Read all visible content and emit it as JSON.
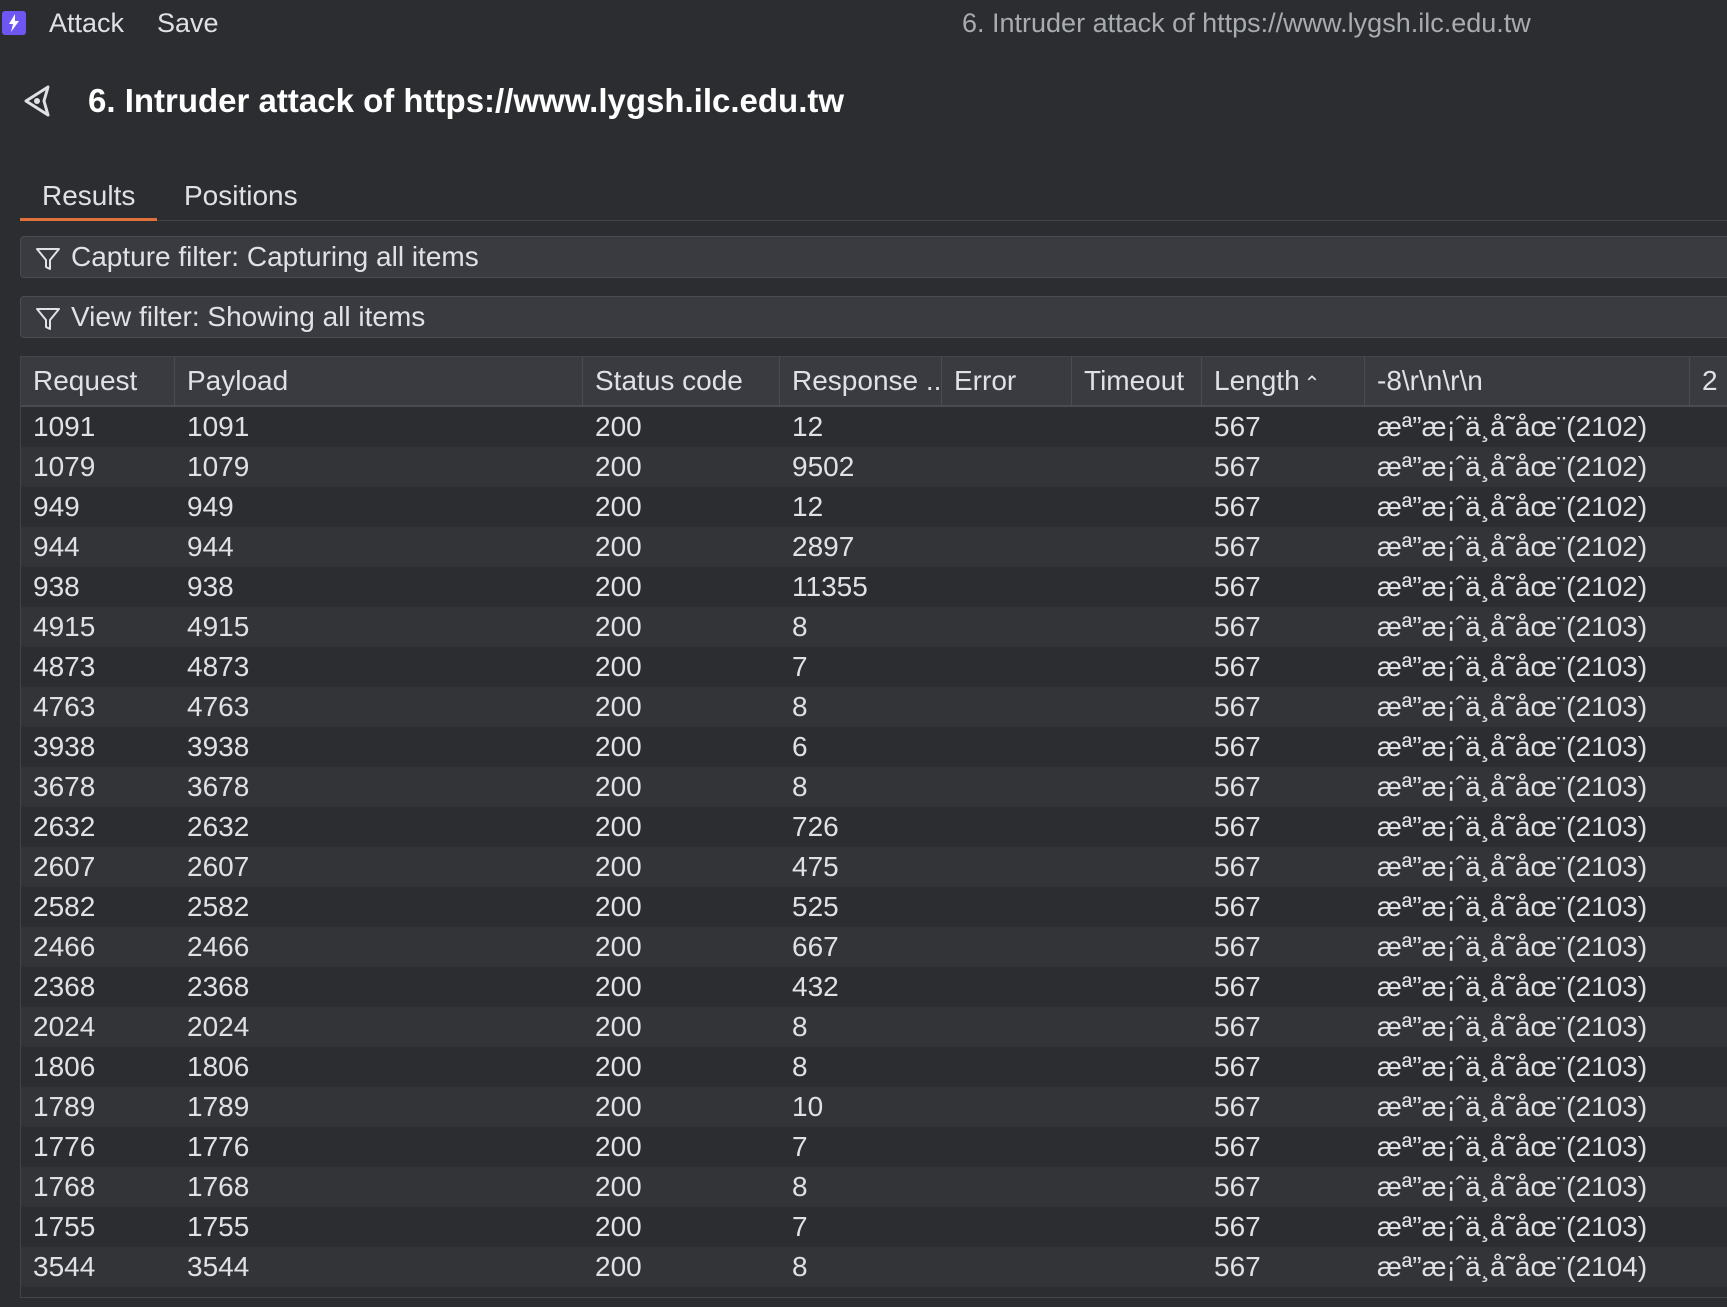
{
  "menubar": {
    "items": [
      "Attack",
      "Save"
    ],
    "window_title": "6. Intruder attack of https://www.lygsh.ilc.edu.tw"
  },
  "header": {
    "title": "6. Intruder attack of https://www.lygsh.ilc.edu.tw",
    "icon": "intruder-icon"
  },
  "tabs": [
    {
      "label": "Results",
      "active": true
    },
    {
      "label": "Positions",
      "active": false
    }
  ],
  "filters": {
    "capture": "Capture filter: Capturing all items",
    "view": "View filter: Showing all items"
  },
  "table": {
    "columns": [
      "Request",
      "Payload",
      "Status code",
      "Response ...",
      "Error",
      "Timeout",
      "Length",
      "-8\\r\\n\\r\\n",
      "2"
    ],
    "sort_column": "Length",
    "sort_direction": "ascending",
    "rows": [
      [
        "1091",
        "1091",
        "200",
        "12",
        "",
        "",
        "567",
        "æª”æ¡ˆä¸å­˜åœ¨(2102)"
      ],
      [
        "1079",
        "1079",
        "200",
        "9502",
        "",
        "",
        "567",
        "æª”æ¡ˆä¸å­˜åœ¨(2102)"
      ],
      [
        "949",
        "949",
        "200",
        "12",
        "",
        "",
        "567",
        "æª”æ¡ˆä¸å­˜åœ¨(2102)"
      ],
      [
        "944",
        "944",
        "200",
        "2897",
        "",
        "",
        "567",
        "æª”æ¡ˆä¸å­˜åœ¨(2102)"
      ],
      [
        "938",
        "938",
        "200",
        "11355",
        "",
        "",
        "567",
        "æª”æ¡ˆä¸å­˜åœ¨(2102)"
      ],
      [
        "4915",
        "4915",
        "200",
        "8",
        "",
        "",
        "567",
        "æª”æ¡ˆä¸å­˜åœ¨(2103)"
      ],
      [
        "4873",
        "4873",
        "200",
        "7",
        "",
        "",
        "567",
        "æª”æ¡ˆä¸å­˜åœ¨(2103)"
      ],
      [
        "4763",
        "4763",
        "200",
        "8",
        "",
        "",
        "567",
        "æª”æ¡ˆä¸å­˜åœ¨(2103)"
      ],
      [
        "3938",
        "3938",
        "200",
        "6",
        "",
        "",
        "567",
        "æª”æ¡ˆä¸å­˜åœ¨(2103)"
      ],
      [
        "3678",
        "3678",
        "200",
        "8",
        "",
        "",
        "567",
        "æª”æ¡ˆä¸å­˜åœ¨(2103)"
      ],
      [
        "2632",
        "2632",
        "200",
        "726",
        "",
        "",
        "567",
        "æª”æ¡ˆä¸å­˜åœ¨(2103)"
      ],
      [
        "2607",
        "2607",
        "200",
        "475",
        "",
        "",
        "567",
        "æª”æ¡ˆä¸å­˜åœ¨(2103)"
      ],
      [
        "2582",
        "2582",
        "200",
        "525",
        "",
        "",
        "567",
        "æª”æ¡ˆä¸å­˜åœ¨(2103)"
      ],
      [
        "2466",
        "2466",
        "200",
        "667",
        "",
        "",
        "567",
        "æª”æ¡ˆä¸å­˜åœ¨(2103)"
      ],
      [
        "2368",
        "2368",
        "200",
        "432",
        "",
        "",
        "567",
        "æª”æ¡ˆä¸å­˜åœ¨(2103)"
      ],
      [
        "2024",
        "2024",
        "200",
        "8",
        "",
        "",
        "567",
        "æª”æ¡ˆä¸å­˜åœ¨(2103)"
      ],
      [
        "1806",
        "1806",
        "200",
        "8",
        "",
        "",
        "567",
        "æª”æ¡ˆä¸å­˜åœ¨(2103)"
      ],
      [
        "1789",
        "1789",
        "200",
        "10",
        "",
        "",
        "567",
        "æª”æ¡ˆä¸å­˜åœ¨(2103)"
      ],
      [
        "1776",
        "1776",
        "200",
        "7",
        "",
        "",
        "567",
        "æª”æ¡ˆä¸å­˜åœ¨(2103)"
      ],
      [
        "1768",
        "1768",
        "200",
        "8",
        "",
        "",
        "567",
        "æª”æ¡ˆä¸å­˜åœ¨(2103)"
      ],
      [
        "1755",
        "1755",
        "200",
        "7",
        "",
        "",
        "567",
        "æª”æ¡ˆä¸å­˜åœ¨(2103)"
      ],
      [
        "3544",
        "3544",
        "200",
        "8",
        "",
        "",
        "567",
        "æª”æ¡ˆä¸å­˜åœ¨(2104)"
      ]
    ]
  },
  "colors": {
    "background": "#2b2d30",
    "accent_tab": "#e2703a",
    "logo": "#6e56f3"
  }
}
